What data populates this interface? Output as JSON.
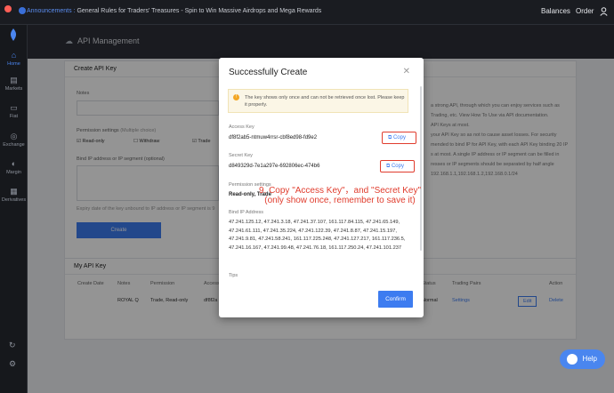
{
  "window": {
    "mac_colors": [
      "#ff5f57",
      "#febc2e",
      "#28c840"
    ]
  },
  "topbar": {
    "announcement_label": "Announcements :",
    "announcement_text": "General Rules for Traders' Treasures - Spin to Win Massive Airdrops and Mega Rewards",
    "balances": "Balances",
    "order": "Order"
  },
  "sidebar": {
    "items": [
      {
        "label": "Home",
        "icon": "home-icon"
      },
      {
        "label": "Markets",
        "icon": "chart-icon"
      },
      {
        "label": "Fiat",
        "icon": "card-icon"
      },
      {
        "label": "Exchange",
        "icon": "exchange-icon"
      },
      {
        "label": "Margin",
        "icon": "margin-icon"
      },
      {
        "label": "Derivatives",
        "icon": "derivatives-icon"
      }
    ]
  },
  "page": {
    "title": "API Management",
    "create_card": {
      "title": "Create API Key",
      "notes_label": "Notes",
      "permission_label": "Permission settings",
      "permission_hint": "(Multiple choice)",
      "perm_read": "Read-only",
      "perm_withdraw": "Withdraw",
      "perm_trade": "Trade",
      "bind_label": "Bind IP address or IP segment (optional)",
      "expiry_text": "Expiry date of the key unbound to IP address or IP segment is 9",
      "create_button": "Create"
    },
    "side_text": [
      "a strong API, through which you can enjoy services such as",
      "Trading, etc. View How To Use via API documentation.",
      "API Keys at most.",
      "your API Key so as not to cause asset losses. For security",
      "mended to bind IP for API Key, with each API Key binding 20 IP",
      "s at most. A single IP address or IP segment can be filled in",
      "resses or IP segments should be separated by half angle",
      "192.168.1.1,192.168.1.2,192.168.0.1/24"
    ],
    "my_api": {
      "title": "My API Key",
      "columns": [
        "Create Date",
        "Notes",
        "Permission",
        "Access",
        "Status",
        "Trading Pairs",
        "Action"
      ],
      "row": {
        "notes": "ROYAL Q",
        "permission": "Trade, Read-only",
        "access": "df8f2a",
        "status": "Normal",
        "pairs": "Settings",
        "edit": "Edit",
        "delete": "Delete"
      }
    }
  },
  "modal": {
    "title": "Successfully Create",
    "warning": "The key shows only once and can not be retrieved once lost. Please keep it properly.",
    "access_label": "Access Key",
    "access_value": "df8f2ab5-ntmuw4rrsr-cbf8ed98-fd9e2",
    "secret_label": "Secret Key",
    "secret_value": "d849329d-7e1a297e-692806ec-474b6",
    "copy_label": "Copy",
    "perm_label": "Permission settings",
    "perm_value": "Read-only, Trade",
    "bind_label": "Bind IP Address",
    "ips": "47.241.125.12, 47.241.3.18, 47.241.37.107, 161.117.84.115, 47.241.65.149, 47.241.61.111, 47.241.35.224, 47.241.122.39, 47.241.8.87, 47.241.15.197, 47.241.9.81, 47.241.58.241, 161.117.225.248, 47.241.127.217, 161.117.236.5, 47.241.16.167, 47.241.99.48, 47.241.76.18, 161.117.250.24, 47.241.101.237",
    "tips_label": "Tips",
    "confirm": "Confirm"
  },
  "annotation": {
    "line1": "9. Copy \"Access Key\"，and \"Secret Key\"",
    "line2": "(only show once, remember to save it)"
  },
  "help": "Help"
}
